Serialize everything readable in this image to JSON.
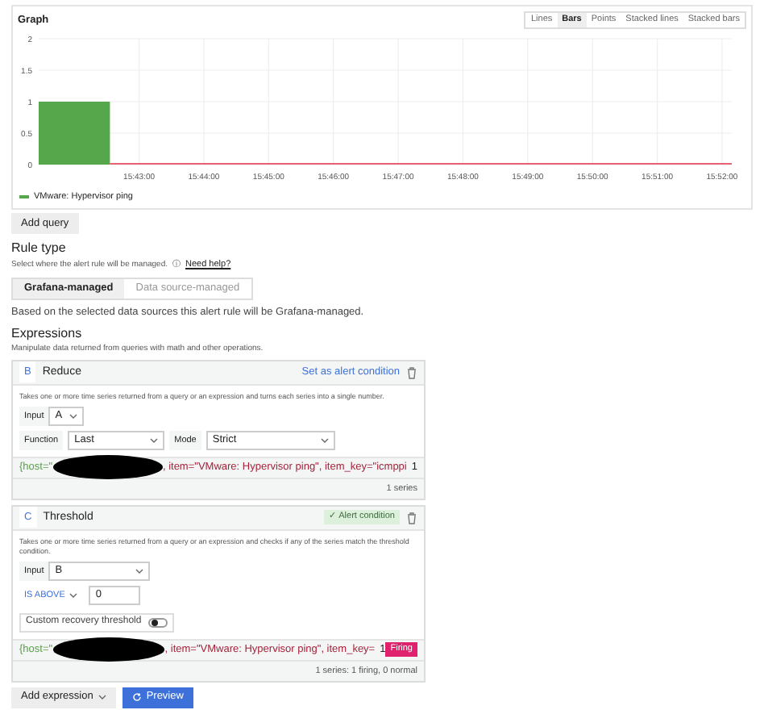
{
  "graph": {
    "title": "Graph",
    "view_modes": [
      {
        "label": "Lines",
        "selected": false
      },
      {
        "label": "Bars",
        "selected": true
      },
      {
        "label": "Points",
        "selected": false
      },
      {
        "label": "Stacked lines",
        "selected": false
      },
      {
        "label": "Stacked bars",
        "selected": false
      }
    ],
    "chart_data": {
      "type": "bar",
      "categories": [
        null,
        "15:43:00",
        "15:44:00",
        "15:45:00",
        "15:46:00",
        "15:47:00",
        "15:48:00",
        "15:49:00",
        "15:50:00",
        "15:51:00",
        "15:52:00"
      ],
      "ylim": [
        0,
        2
      ],
      "yticks": [
        0,
        {
          "value": 0.5,
          "label": "0.5"
        },
        1,
        {
          "value": 1.5,
          "label": "1.5"
        },
        2
      ],
      "series": [
        {
          "name": "VMware: Hypervisor ping",
          "color": "#56a64b",
          "values": [
            1,
            null,
            null,
            null,
            null,
            null,
            null,
            null,
            null,
            null,
            null
          ]
        }
      ],
      "grid": true,
      "ref_lines": [
        {
          "color": "#e02f44"
        }
      ]
    }
  },
  "add_query": "Add query",
  "rule_type": {
    "title": "Rule type",
    "description": "Select where the alert rule will be managed.",
    "help_icon": "ⓘ",
    "help_link": "Need help?",
    "options": [
      {
        "label": "Grafana-managed",
        "selected": true
      },
      {
        "label": "Data source-managed",
        "selected": false
      }
    ],
    "note": "Based on the selected data sources this alert rule will be Grafana-managed."
  },
  "expressions": {
    "title": "Expressions",
    "description": "Manipulate data returned from queries with math and other operations.",
    "cards": [
      {
        "kind": "reduce",
        "ref": "B",
        "name": "Reduce",
        "condition_action": "Set as alert condition",
        "is_condition": false,
        "description": "Takes one or more time series returned from a query or an expression and turns each series into a single number.",
        "input_label": "Input",
        "input": "A",
        "function_label": "Function",
        "function": "Last",
        "mode_label": "Mode",
        "mode": "Strict",
        "series_host": "{host=\"",
        "series_item": ", item=\"VMware: Hypervisor ping\", item_key=\"icmppi",
        "series_value": "1",
        "series_firing": false,
        "summary": "1 series"
      },
      {
        "kind": "threshold",
        "ref": "C",
        "name": "Threshold",
        "condition_mark": "✓",
        "condition_action": "Alert condition",
        "is_condition": true,
        "description": "Takes one or more time series returned from a query or an expression and checks if any of the series match the threshold condition.",
        "input_label": "Input",
        "input": "B",
        "operator": "IS ABOVE",
        "threshold": "0",
        "recovery_label": "Custom recovery threshold",
        "recovery_on": false,
        "series_host": "{host=\"",
        "series_item": ", item=\"VMware: Hypervisor ping\", item_key=",
        "series_value": "1",
        "series_firing": true,
        "series_state": "Firing",
        "summary": "1 series: 1 firing, 0 normal"
      }
    ]
  },
  "actions": {
    "add_expression": "Add expression",
    "preview": "Preview"
  }
}
